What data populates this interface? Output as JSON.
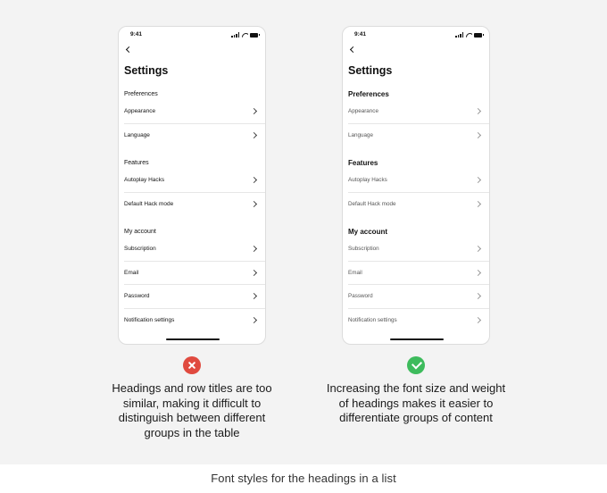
{
  "caption": "Font styles for the headings in a list",
  "phones": {
    "left": {
      "time": "9:41",
      "title": "Settings",
      "sections": [
        {
          "heading": "Preferences",
          "rows": [
            "Appearance",
            "Language"
          ]
        },
        {
          "heading": "Features",
          "rows": [
            "Autoplay Hacks",
            "Default Hack mode"
          ]
        },
        {
          "heading": "My account",
          "rows": [
            "Subscription",
            "Email",
            "Password",
            "Notification settings"
          ]
        }
      ]
    },
    "right": {
      "time": "9:41",
      "title": "Settings",
      "sections": [
        {
          "heading": "Preferences",
          "rows": [
            "Appearance",
            "Language"
          ]
        },
        {
          "heading": "Features",
          "rows": [
            "Autoplay Hacks",
            "Default Hack mode"
          ]
        },
        {
          "heading": "My account",
          "rows": [
            "Subscription",
            "Email",
            "Password",
            "Notification settings"
          ]
        }
      ]
    }
  },
  "verdicts": {
    "left": {
      "icon": "cross-icon",
      "color": "#e04a3f",
      "lines": [
        "Headings and row titles are too",
        "similar, making it difficult to",
        "distinguish between different",
        "groups in the table"
      ]
    },
    "right": {
      "icon": "check-icon",
      "color": "#3dbb5c",
      "lines": [
        "Increasing the font size and weight",
        "of headings makes it easier to",
        "differentiate groups of content"
      ]
    }
  }
}
